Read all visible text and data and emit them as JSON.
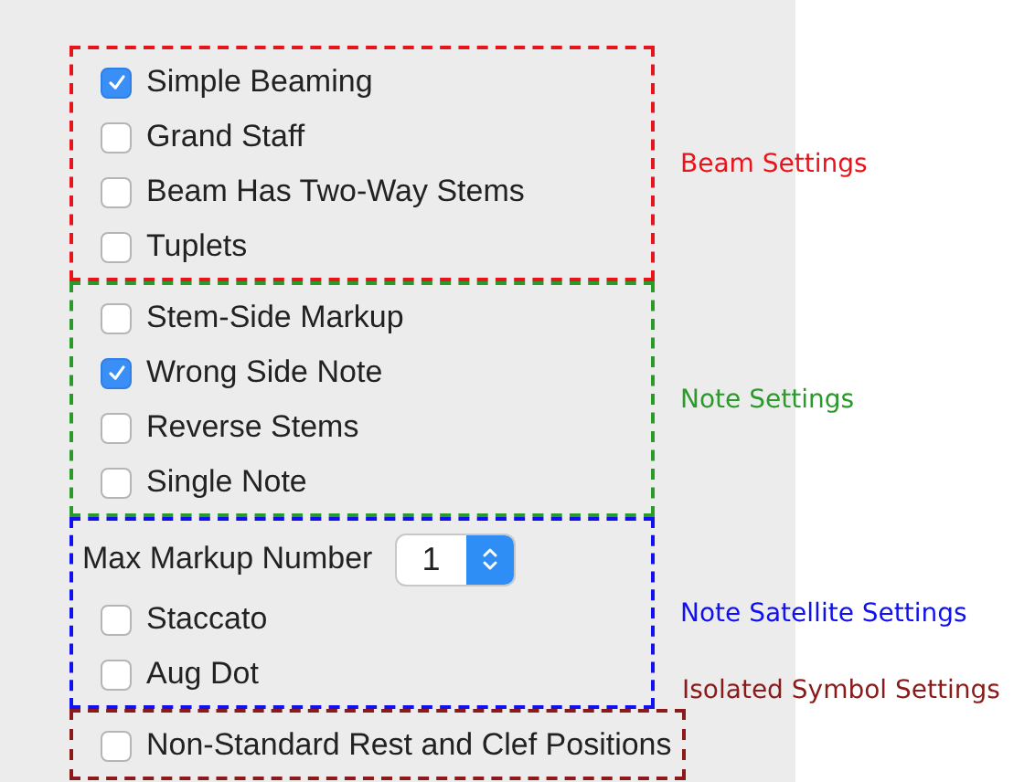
{
  "groups": [
    {
      "title": "Beam Settings",
      "color": "#e8141c",
      "items": [
        {
          "kind": "checkbox",
          "label": "Simple Beaming",
          "checked": true
        },
        {
          "kind": "checkbox",
          "label": "Grand Staff",
          "checked": false
        },
        {
          "kind": "checkbox",
          "label": "Beam Has Two-Way Stems",
          "checked": false
        },
        {
          "kind": "checkbox",
          "label": "Tuplets",
          "checked": false
        }
      ]
    },
    {
      "title": "Note Settings",
      "color": "#2a9a2a",
      "items": [
        {
          "kind": "checkbox",
          "label": "Stem-Side Markup",
          "checked": false
        },
        {
          "kind": "checkbox",
          "label": "Wrong Side Note",
          "checked": true
        },
        {
          "kind": "checkbox",
          "label": "Reverse Stems",
          "checked": false
        },
        {
          "kind": "checkbox",
          "label": "Single Note",
          "checked": false
        }
      ]
    },
    {
      "title": "Note Satellite Settings",
      "color": "#1010f0",
      "items": [
        {
          "kind": "stepper",
          "label": "Max Markup Number",
          "value": "1"
        },
        {
          "kind": "checkbox",
          "label": "Staccato",
          "checked": false
        },
        {
          "kind": "checkbox",
          "label": "Aug Dot",
          "checked": false
        }
      ]
    },
    {
      "title": "Isolated Symbol Settings",
      "color": "#8b1a1a",
      "items": [
        {
          "kind": "checkbox",
          "label": "Non-Standard Rest and Clef Positions",
          "checked": false
        }
      ]
    }
  ]
}
